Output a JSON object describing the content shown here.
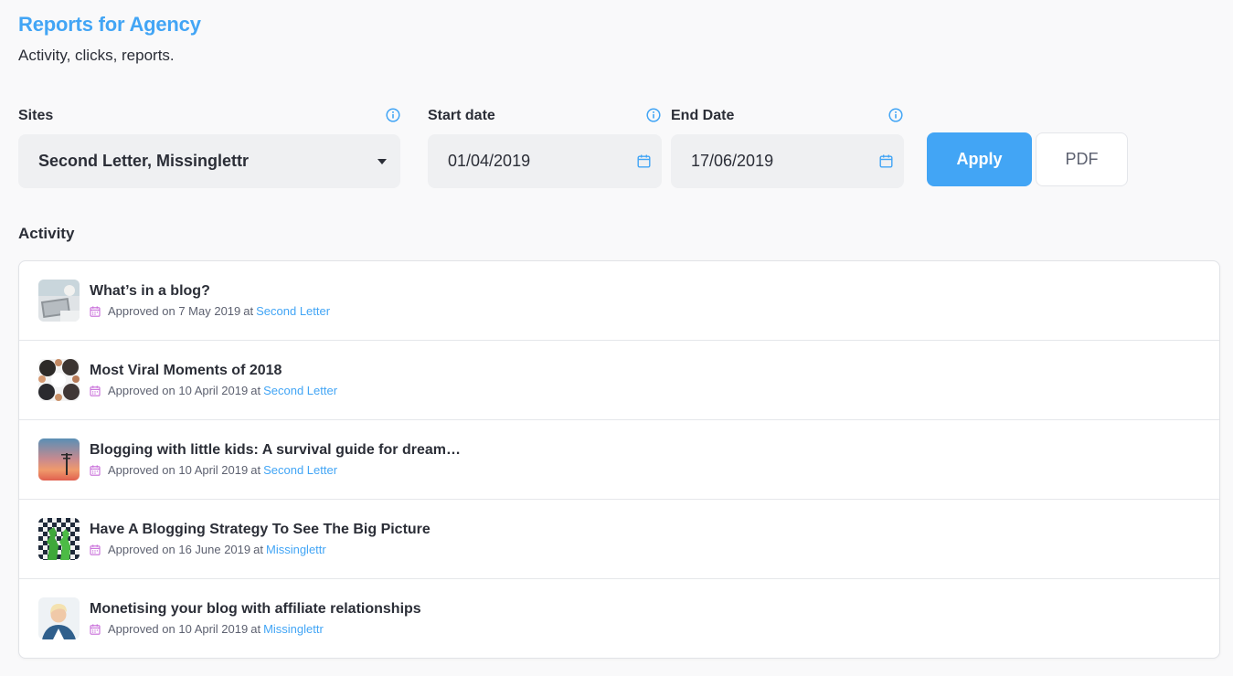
{
  "header": {
    "title": "Reports for Agency",
    "subtitle": "Activity, clicks, reports."
  },
  "filters": {
    "sites_label": "Sites",
    "sites_value": "Second Letter, Missinglettr",
    "start_label": "Start date",
    "start_value": "01/04/2019",
    "end_label": "End Date",
    "end_value": "17/06/2019",
    "apply_label": "Apply",
    "pdf_label": "PDF"
  },
  "activity": {
    "section_title": "Activity",
    "items": [
      {
        "title": "What’s in a blog?",
        "prefix": "Approved on 7 May 2019",
        "at": "at",
        "site": "Second Letter",
        "thumb": "laptop-desk"
      },
      {
        "title": "Most Viral Moments of 2018",
        "prefix": "Approved on 10 April 2019",
        "at": "at",
        "site": "Second Letter",
        "thumb": "group-circle"
      },
      {
        "title": "Blogging with little kids: A survival guide for dream…",
        "prefix": "Approved on 10 April 2019",
        "at": "at",
        "site": "Second Letter",
        "thumb": "sunset-pole"
      },
      {
        "title": "Have A Blogging Strategy To See The Big Picture",
        "prefix": "Approved on 16 June 2019",
        "at": "at",
        "site": "Missinglettr",
        "thumb": "chess-board"
      },
      {
        "title": "Monetising your blog with affiliate relationships",
        "prefix": "Approved on 10 April 2019",
        "at": "at",
        "site": "Missinglettr",
        "thumb": "woman-portrait"
      }
    ]
  },
  "colors": {
    "accent": "#42a5f5",
    "calendar_icon": "#c76bd9",
    "text": "#2b2e37",
    "control_bg": "#eff0f2"
  },
  "icons": [
    "info-icon",
    "dropdown-caret-icon",
    "calendar-icon",
    "calendar-small-icon"
  ]
}
